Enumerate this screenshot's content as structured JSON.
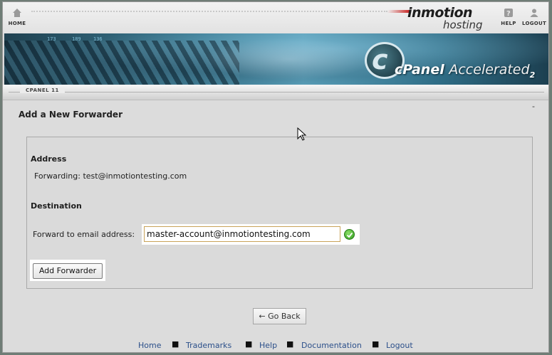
{
  "topbar": {
    "home_label": "HOME",
    "help_label": "HELP",
    "logout_label": "LOGOUT",
    "logo_primary": "inmotion",
    "logo_secondary": "hosting"
  },
  "banner": {
    "led_1": "173",
    "led_2": "189",
    "led_3": "136",
    "cpanel_text": "cPanel",
    "accelerated_text": "Accelerated",
    "version_mark": "2"
  },
  "breadcrumb": {
    "label": "CPANEL 11"
  },
  "page": {
    "title": "Add a New Forwarder",
    "dash": "-"
  },
  "form": {
    "address_heading": "Address",
    "forwarding_label": "Forwarding:",
    "forwarding_value": "test@inmotiontesting.com",
    "destination_heading": "Destination",
    "forward_to_label": "Forward to email address:",
    "forward_to_value": "master-account@inmotiontesting.com",
    "add_button": "Add Forwarder"
  },
  "go_back": "← Go Back",
  "footer": {
    "links": [
      "Home",
      "Trademarks",
      "Help",
      "Documentation",
      "Logout"
    ],
    "separator": "■"
  }
}
